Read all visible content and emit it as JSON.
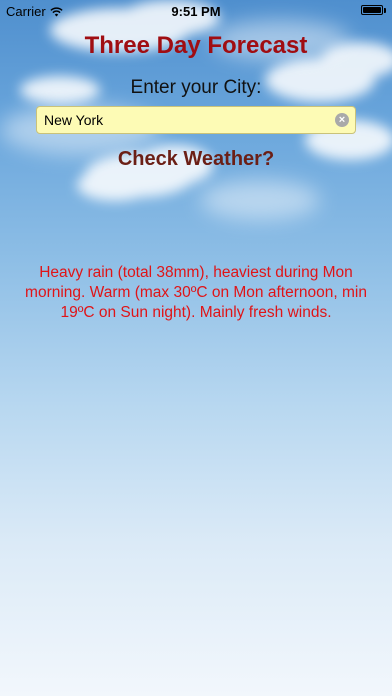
{
  "status": {
    "carrier": "Carrier",
    "time": "9:51 PM",
    "battery_level": 1.0
  },
  "header": {
    "title": "Three Day Forecast"
  },
  "form": {
    "prompt": "Enter your City:",
    "city_value": "New York",
    "clear_icon": "clear-circle-icon",
    "check_label": "Check Weather?"
  },
  "forecast": {
    "text": "Heavy rain (total 38mm), heaviest during Mon morning. Warm (max 30ºC on Mon afternoon, min 19ºC on Sun night). Mainly fresh winds."
  },
  "colors": {
    "title": "#a00d12",
    "check_button": "#6b1f16",
    "forecast_text": "#e01417",
    "input_background": "#fdfbb5"
  }
}
